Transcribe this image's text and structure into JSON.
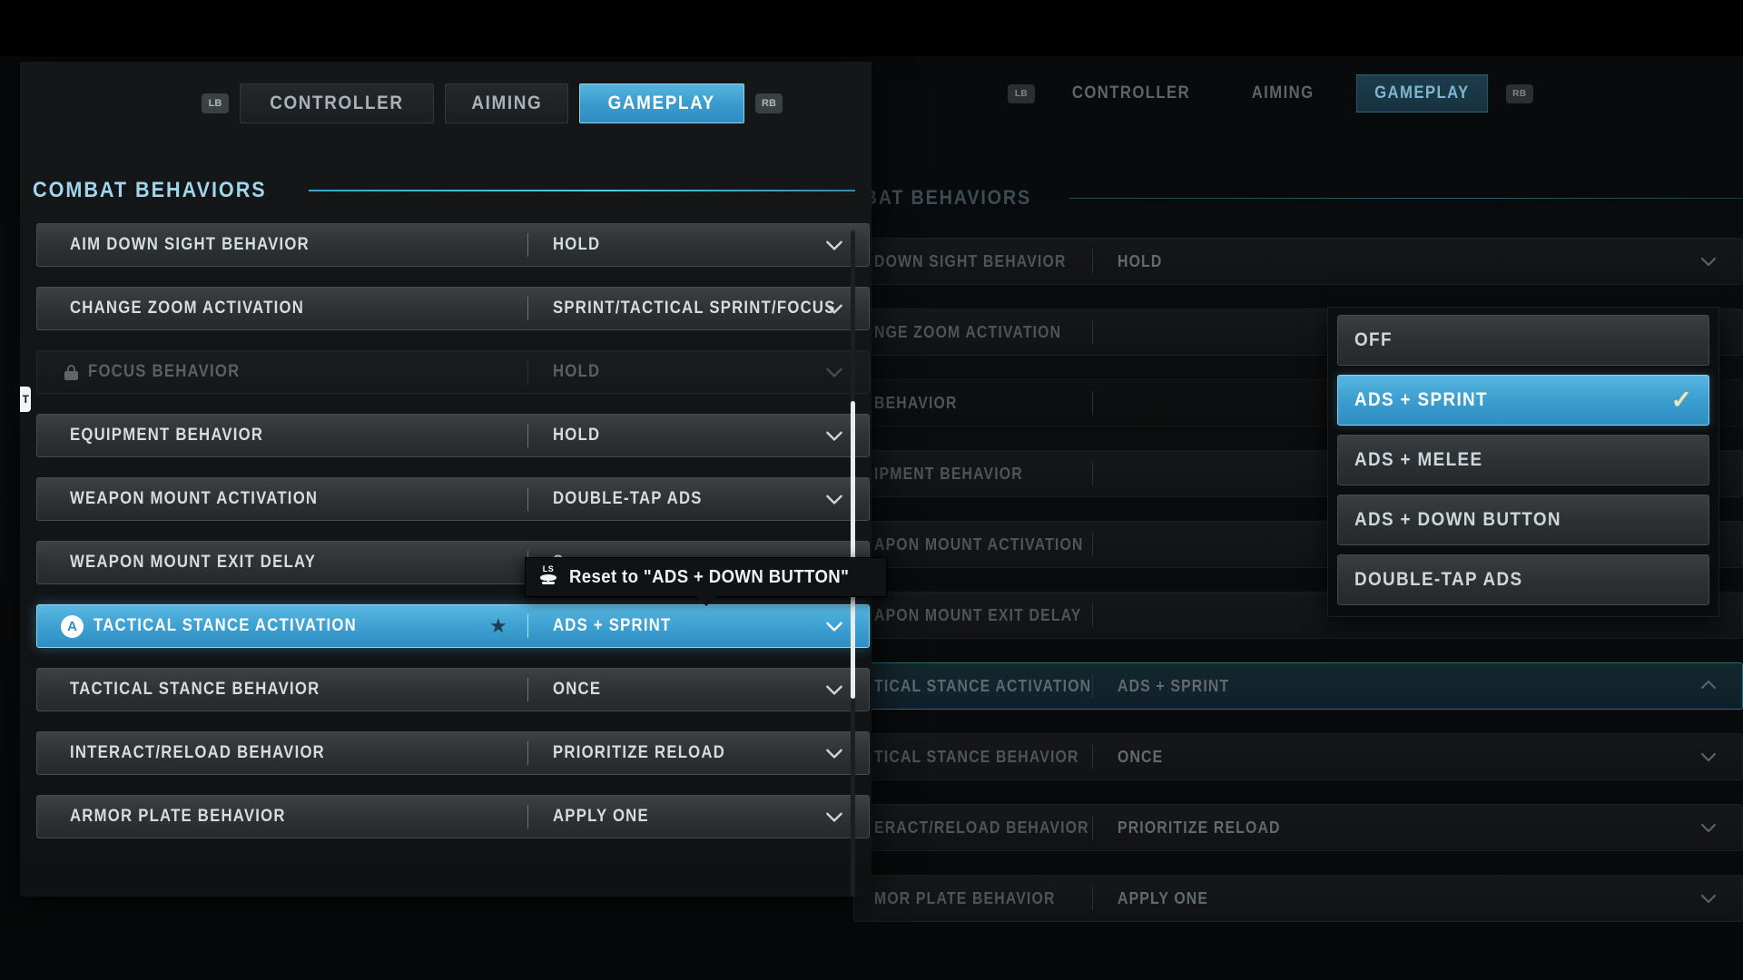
{
  "tabs": {
    "left_bumper": "LB",
    "right_bumper": "RB",
    "items": [
      {
        "label": "CONTROLLER",
        "active": false
      },
      {
        "label": "AIMING",
        "active": false
      },
      {
        "label": "GAMEPLAY",
        "active": true
      }
    ]
  },
  "section": {
    "title": "COMBAT BEHAVIORS"
  },
  "settings_rows": [
    {
      "label": "AIM DOWN SIGHT BEHAVIOR",
      "value": "HOLD",
      "state": "normal",
      "chevron": "down"
    },
    {
      "label": "CHANGE ZOOM ACTIVATION",
      "value": "SPRINT/TACTICAL SPRINT/FOCUS",
      "state": "normal",
      "chevron": "down"
    },
    {
      "label": "FOCUS BEHAVIOR",
      "value": "HOLD",
      "state": "locked",
      "chevron": "down",
      "icon": "lock-icon"
    },
    {
      "label": "EQUIPMENT BEHAVIOR",
      "value": "HOLD",
      "state": "normal",
      "chevron": "down"
    },
    {
      "label": "WEAPON MOUNT ACTIVATION",
      "value": "DOUBLE-TAP ADS",
      "state": "normal",
      "chevron": "down"
    },
    {
      "label": "WEAPON MOUNT EXIT DELAY",
      "value": "S",
      "state": "normal",
      "chevron": "down"
    },
    {
      "label": "TACTICAL STANCE ACTIVATION",
      "value": "ADS + SPRINT",
      "state": "highlighted",
      "chevron": "down",
      "icon": "a-button-icon",
      "badge": "★"
    },
    {
      "label": "TACTICAL STANCE BEHAVIOR",
      "value": "ONCE",
      "state": "normal",
      "chevron": "down"
    },
    {
      "label": "INTERACT/RELOAD BEHAVIOR",
      "value": "PRIORITIZE RELOAD",
      "state": "normal",
      "chevron": "down"
    },
    {
      "label": "ARMOR PLATE BEHAVIOR",
      "value": "APPLY ONE",
      "state": "normal",
      "chevron": "down"
    }
  ],
  "tooltip": {
    "button_hint": "LS",
    "text": "Reset to \"ADS + DOWN BUTTON\""
  },
  "dropdown": {
    "options": [
      {
        "label": "OFF",
        "selected": false
      },
      {
        "label": "ADS + SPRINT",
        "selected": true
      },
      {
        "label": "ADS + MELEE",
        "selected": false
      },
      {
        "label": "ADS + DOWN BUTTON",
        "selected": false
      },
      {
        "label": "DOUBLE-TAP ADS",
        "selected": false
      }
    ],
    "checkmark": "✓"
  },
  "background_rows": [
    {
      "label": "DOWN SIGHT BEHAVIOR",
      "value": "HOLD",
      "state": "normal",
      "chevron": "down"
    },
    {
      "label": "NGE ZOOM ACTIVATION",
      "value": "",
      "state": "normal",
      "chevron": "none"
    },
    {
      "label": "BEHAVIOR",
      "value": "",
      "state": "locked",
      "chevron": "none"
    },
    {
      "label": "IPMENT BEHAVIOR",
      "value": "",
      "state": "normal",
      "chevron": "none"
    },
    {
      "label": "APON MOUNT ACTIVATION",
      "value": "",
      "state": "normal",
      "chevron": "none"
    },
    {
      "label": "APON MOUNT EXIT DELAY",
      "value": "",
      "state": "normal",
      "chevron": "none"
    },
    {
      "label": "TICAL STANCE ACTIVATION",
      "value": "ADS + SPRINT",
      "state": "selected",
      "chevron": "up"
    },
    {
      "label": "TICAL STANCE BEHAVIOR",
      "value": "ONCE",
      "state": "normal",
      "chevron": "down"
    },
    {
      "label": "ERACT/RELOAD BEHAVIOR",
      "value": "PRIORITIZE RELOAD",
      "state": "normal",
      "chevron": "down"
    },
    {
      "label": "MOR PLATE BEHAVIOR",
      "value": "APPLY ONE",
      "state": "normal",
      "chevron": "down"
    }
  ],
  "edge_badge": {
    "label": "T"
  },
  "colors": {
    "accent_blue": "#3ea2d2",
    "accent_cyan": "#55c6e4",
    "checkmark_cream": "#efe3b6",
    "panel_bg": "#141618",
    "row_bg": "#2e3234"
  }
}
